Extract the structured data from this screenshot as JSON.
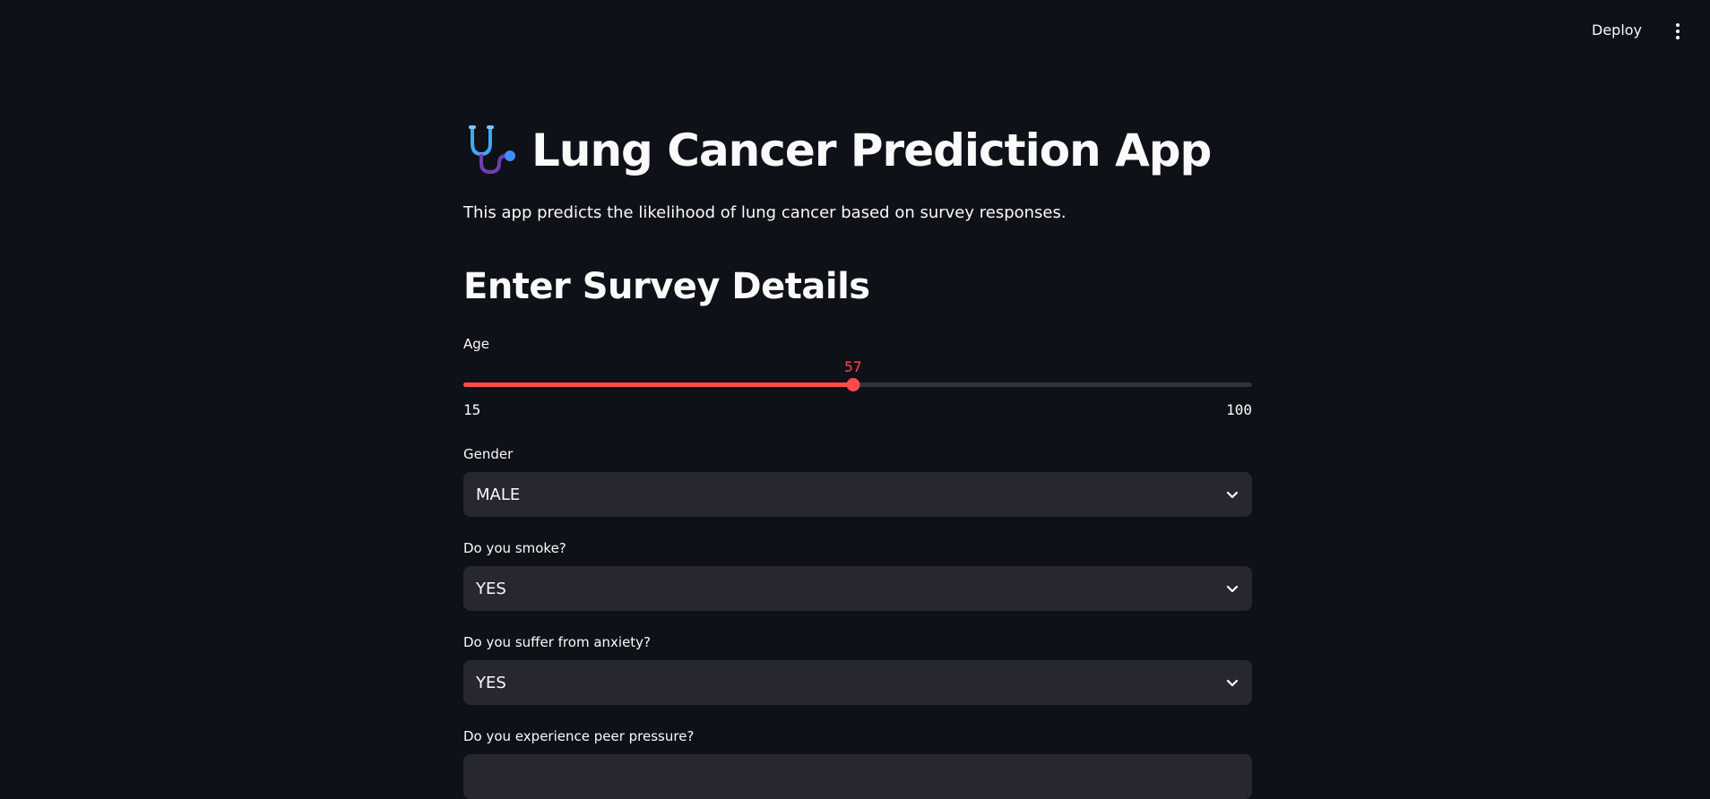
{
  "header": {
    "deploy_label": "Deploy"
  },
  "app": {
    "title": "Lung Cancer Prediction App",
    "icon": "stethoscope-icon",
    "subtitle": "This app predicts the likelihood of lung cancer based on survey responses."
  },
  "form": {
    "heading": "Enter Survey Details",
    "age": {
      "label": "Age",
      "value": "57",
      "min": "15",
      "max": "100"
    },
    "gender": {
      "label": "Gender",
      "value": "MALE"
    },
    "smoking": {
      "label": "Do you smoke?",
      "value": "YES"
    },
    "anxiety": {
      "label": "Do you suffer from anxiety?",
      "value": "YES"
    },
    "peer_pressure": {
      "label": "Do you experience peer pressure?",
      "value": ""
    }
  },
  "colors": {
    "background": "#0e1117",
    "accent": "#ff4b4b",
    "select_bg": "#262730",
    "text": "#fafafa"
  }
}
